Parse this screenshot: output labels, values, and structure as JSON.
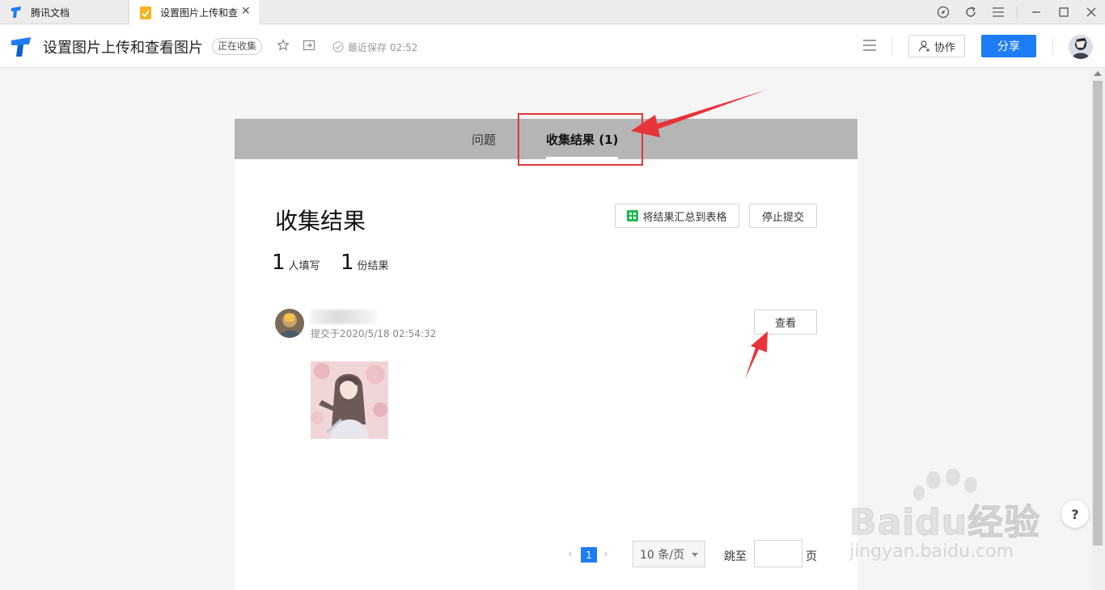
{
  "browser_tabs": [
    {
      "label": "腾讯文档"
    },
    {
      "label": "设置图片上传和查"
    }
  ],
  "doc": {
    "title": "设置图片上传和查看图片",
    "status_badge": "正在收集",
    "save_status": "最近保存 02:52",
    "collab_label": "协作",
    "share_label": "分享"
  },
  "panel": {
    "tabs": [
      {
        "label": "问题"
      },
      {
        "label": "收集结果 (1)"
      }
    ],
    "title": "收集结果",
    "export_label": "将结果汇总到表格",
    "stop_label": "停止提交",
    "stats": [
      {
        "value": "1",
        "unit": "人填写"
      },
      {
        "value": "1",
        "unit": "份结果"
      }
    ],
    "submission": {
      "time": "提交于2020/5/18 02:54:32",
      "view_label": "查看"
    },
    "pagination": {
      "prev": "‹",
      "current": "1",
      "next": "›",
      "page_size": "10 条/页",
      "jump_label": "跳至",
      "page_label": "页"
    }
  },
  "help_label": "?",
  "watermark": {
    "main": "Baidu经验",
    "sub": "jingyan.baidu.com"
  },
  "colors": {
    "accent": "#1e7cf5",
    "annotation": "#e8333a",
    "tab_bar": "#b5b5b5"
  }
}
